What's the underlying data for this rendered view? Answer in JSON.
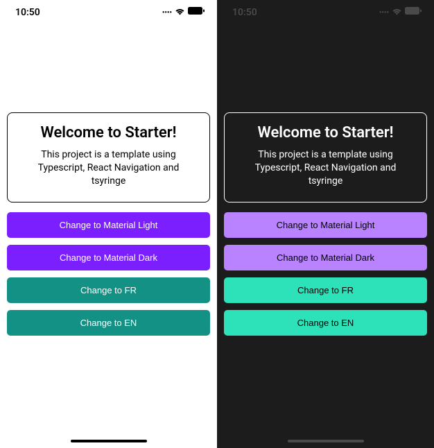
{
  "status": {
    "time": "10:50"
  },
  "card": {
    "title": "Welcome to Starter!",
    "description": "This project is a template using Typescript, React Navigation and tsyringe"
  },
  "buttons": {
    "material_light": "Change to Material Light",
    "material_dark": "Change to Material Dark",
    "lang_fr": "Change to FR",
    "lang_en": "Change to EN"
  }
}
